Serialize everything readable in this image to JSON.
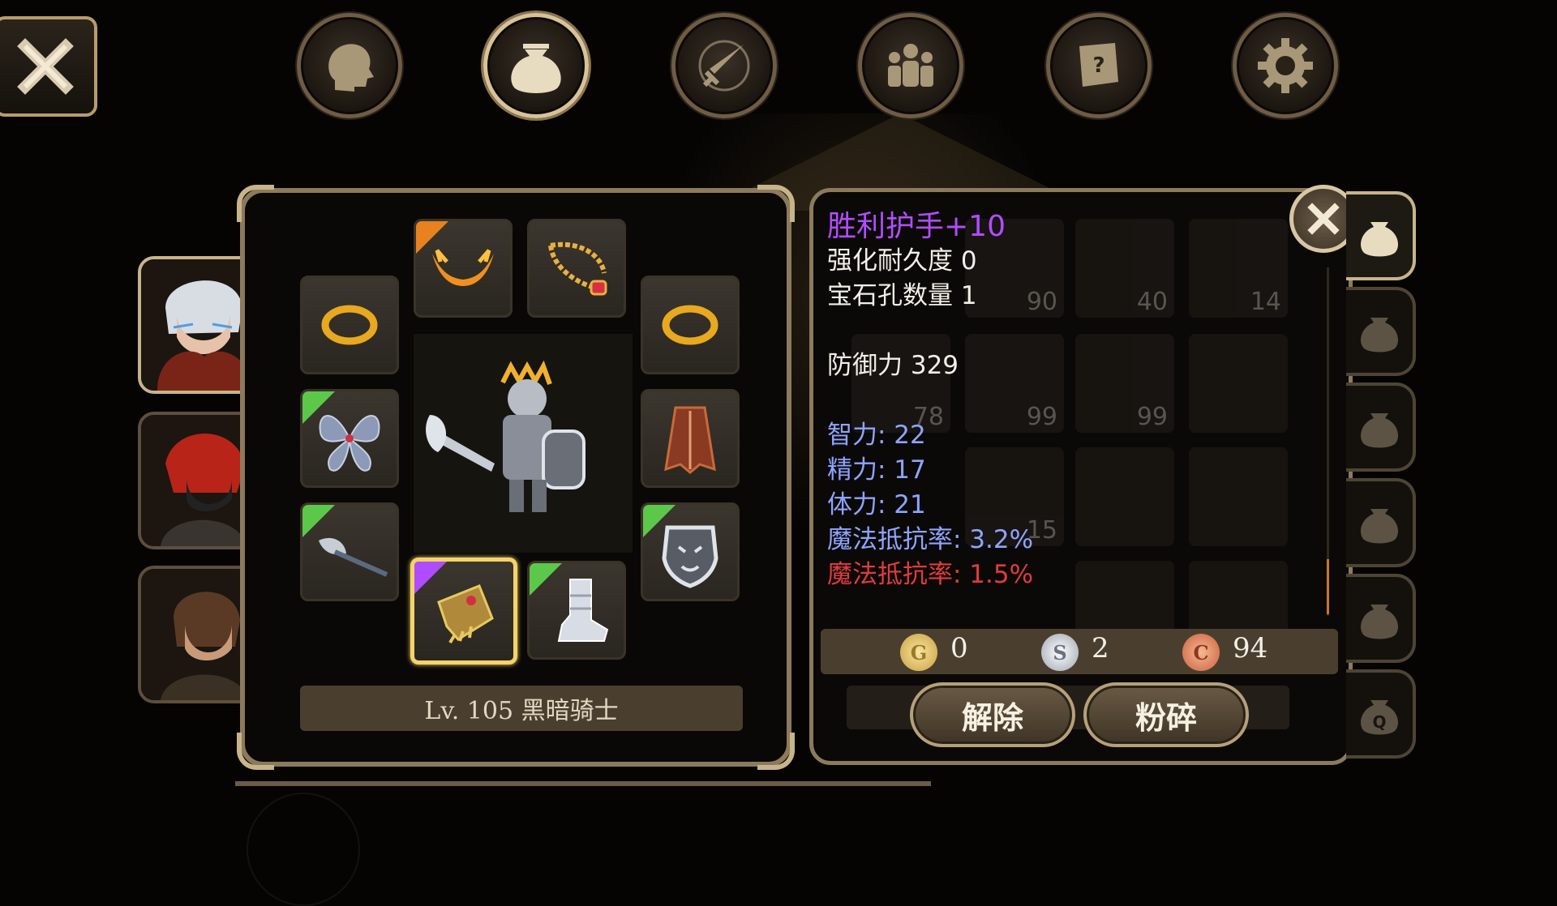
{
  "top_nav": {
    "close_icon": "close-x-icon",
    "buttons": [
      {
        "name": "profile",
        "icon": "head-silhouette-icon",
        "active": false
      },
      {
        "name": "inventory",
        "icon": "bag-icon",
        "active": true
      },
      {
        "name": "skills",
        "icon": "sword-compass-icon",
        "active": false
      },
      {
        "name": "party",
        "icon": "people-icon",
        "active": false
      },
      {
        "name": "quests",
        "icon": "scroll-question-icon",
        "active": false
      },
      {
        "name": "settings",
        "icon": "gear-icon",
        "active": false
      }
    ]
  },
  "characters": [
    {
      "name": "white-haired-warrior",
      "active": true
    },
    {
      "name": "red-haired-ninja",
      "active": false
    },
    {
      "name": "brown-haired-swordsman",
      "active": false
    }
  ],
  "equipment": {
    "character_label": "Lv. 105 黑暗骑士",
    "slots": [
      {
        "slot": "helmet",
        "icon": "flame-horns-icon",
        "rarity_color": "#e8821e"
      },
      {
        "slot": "necklace",
        "icon": "gold-necklace-icon",
        "rarity_color": null
      },
      {
        "slot": "ring-left",
        "icon": "gold-ring-icon",
        "rarity_color": null
      },
      {
        "slot": "ring-right",
        "icon": "gold-ring-icon",
        "rarity_color": null
      },
      {
        "slot": "wings",
        "icon": "butterfly-wings-icon",
        "rarity_color": "#5cc84a"
      },
      {
        "slot": "armor",
        "icon": "red-cape-icon",
        "rarity_color": null
      },
      {
        "slot": "weapon",
        "icon": "battle-axe-icon",
        "rarity_color": "#5cc84a"
      },
      {
        "slot": "shield",
        "icon": "demon-shield-icon",
        "rarity_color": "#5cc84a"
      },
      {
        "slot": "gloves",
        "icon": "gold-gauntlet-icon",
        "rarity_color": "#b04cff",
        "selected": true
      },
      {
        "slot": "boots",
        "icon": "silver-boot-icon",
        "rarity_color": "#5cc84a"
      }
    ]
  },
  "item_detail": {
    "name": "胜利护手+10",
    "name_color": "#b24cff",
    "durability": "强化耐久度 0",
    "gem_slots": "宝石孔数量 1",
    "defense": "防御力 329",
    "stats_blue": [
      "智力: 22",
      "精力: 17",
      "体力: 21",
      "魔法抵抗率: 3.2%"
    ],
    "stat_red": "魔法抵抗率: 1.5%",
    "close_icon": "close-x-icon"
  },
  "inventory_counts": [
    "90",
    "40",
    "14",
    "78",
    "99",
    "99",
    "15"
  ],
  "currency": {
    "gold": {
      "letter": "G",
      "value": "0"
    },
    "silver": {
      "letter": "S",
      "value": "2"
    },
    "copper": {
      "letter": "C",
      "value": "94"
    }
  },
  "actions": {
    "unequip_label": "解除",
    "smash_label": "粉碎"
  },
  "bag_tabs": [
    {
      "name": "bag-1",
      "active": true
    },
    {
      "name": "bag-2",
      "active": false
    },
    {
      "name": "bag-3",
      "active": false
    },
    {
      "name": "bag-4",
      "active": false
    },
    {
      "name": "bag-5",
      "active": false
    },
    {
      "name": "quest-bag",
      "active": false
    }
  ]
}
